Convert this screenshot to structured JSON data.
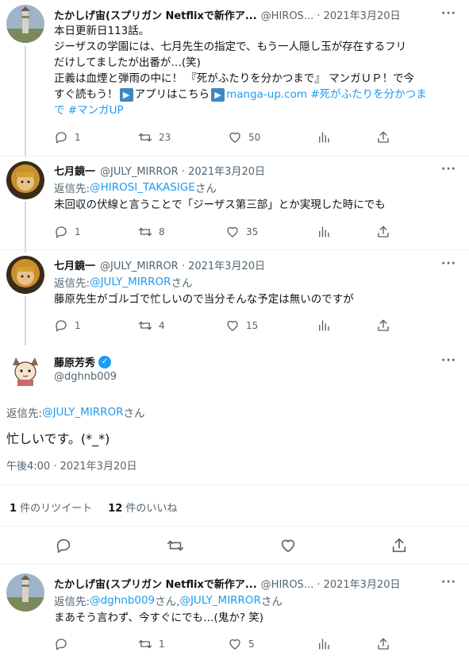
{
  "tweet1": {
    "name": "たかしげ宙(スプリガン Netflixで新作ア...",
    "handle_date": "@HIROS... · 2021年3月20日",
    "line1": "本日更新日113話。",
    "line2": "ジーザスの学園には、七月先生の指定で、もう一人隠し玉が存在するフリ",
    "line3": "だけしてましたが出番が…(笑)",
    "line4": "正義は血煙と弾雨の中に！ 『死がふたりを分かつまで』 マンガＵＰ！で今",
    "line5_a": "すぐ読もう！",
    "line5_b": "アプリはこちら",
    "line5_link": "manga-up.com #死がふたりを分かつま",
    "line6_link": "で #マンガUP",
    "arrow_glyph": "▶",
    "replies": "1",
    "retweets": "23",
    "likes": "50"
  },
  "tweet2": {
    "name": "七月鏡一",
    "handle_date": "@JULY_MIRROR · 2021年3月20日",
    "reply_prefix": "返信先: ",
    "reply_handle": "@HIROSI_TAKASIGE",
    "reply_suffix": "さん",
    "text": "未回収の伏線と言うことで「ジーザス第三部」とか実現した時にでも",
    "replies": "1",
    "retweets": "8",
    "likes": "35"
  },
  "tweet3": {
    "name": "七月鏡一",
    "handle_date": "@JULY_MIRROR · 2021年3月20日",
    "reply_prefix": "返信先: ",
    "reply_handle": "@JULY_MIRROR",
    "reply_suffix": "さん",
    "text": "藤原先生がゴルゴで忙しいので当分そんな予定は無いのですが",
    "replies": "1",
    "retweets": "4",
    "likes": "15"
  },
  "main_tweet": {
    "name": "藤原芳秀",
    "handle": "@dghnb009",
    "verified_glyph": "✓",
    "reply_prefix": "返信先: ",
    "reply_handle": "@JULY_MIRROR",
    "reply_suffix": "さん",
    "text": "忙しいです。(*_*)",
    "timestamp": "午後4:00 · 2021年3月20日",
    "retweet_count": "1",
    "retweet_label": " 件のリツイート",
    "like_count": "12",
    "like_label": " 件のいいね"
  },
  "tweet5": {
    "name": "たかしげ宙(スプリガン Netflixで新作ア...",
    "handle_date": "@HIROS... · 2021年3月20日",
    "reply_prefix": "返信先: ",
    "reply_handle1": "@dghnb009",
    "reply_mid": "さん, ",
    "reply_handle2": "@JULY_MIRROR",
    "reply_suffix": "さん",
    "text": "まあそう言わず、今すぐにでも…(鬼か? 笑)",
    "retweets": "1",
    "likes": "5"
  },
  "more_glyph": "···",
  "colors": {
    "accent": "#1d9bf0",
    "muted": "#536471",
    "divider": "#eff3f4",
    "thread": "#cfd9de"
  }
}
